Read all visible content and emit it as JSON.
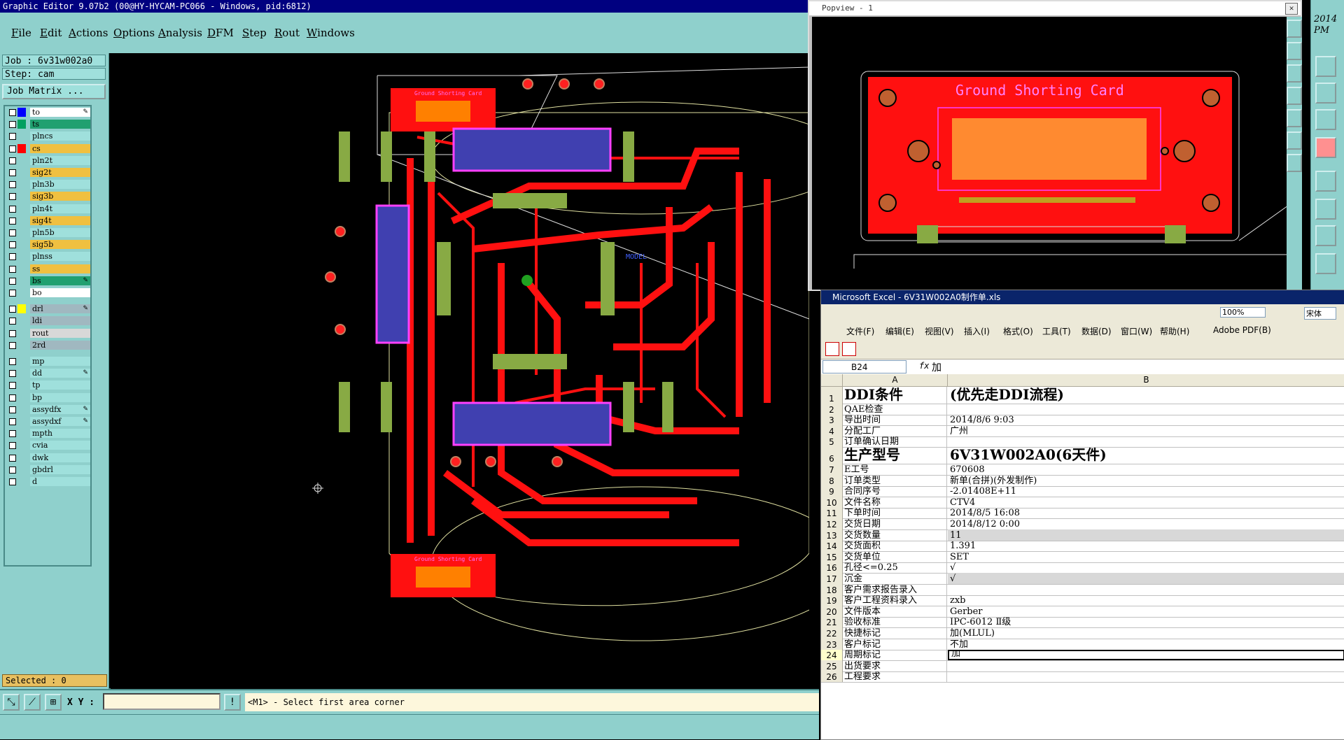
{
  "editor": {
    "title": "Graphic Editor 9.07b2 (00@HY-HYCAM-PC066 - Windows, pid:6812)",
    "menu": [
      "File",
      "Edit",
      "Actions",
      "Options",
      "Analysis",
      "DFM",
      "Step",
      "Rout",
      "Windows"
    ],
    "job_label": "Job : 6v31w002a0",
    "step_label": "Step: cam",
    "job_matrix_label": "Job Matrix ...",
    "layers": [
      {
        "name": "to",
        "color": "#0000ff",
        "name_bg": "#ffffff",
        "edit": true
      },
      {
        "name": "ts",
        "color": "#00a060",
        "name_bg": "#20a070",
        "edit": false
      },
      {
        "name": "plncs",
        "color": "",
        "name_bg": "#9fe0dc",
        "edit": false
      },
      {
        "name": "cs",
        "color": "#ff0000",
        "name_bg": "#f0c040",
        "edit": false
      },
      {
        "name": "pln2t",
        "color": "",
        "name_bg": "#9fe0dc",
        "edit": false
      },
      {
        "name": "sig2t",
        "color": "",
        "name_bg": "#f0c040",
        "edit": false
      },
      {
        "name": "pln3b",
        "color": "",
        "name_bg": "#9fe0dc",
        "edit": false
      },
      {
        "name": "sig3b",
        "color": "",
        "name_bg": "#f0c040",
        "edit": false
      },
      {
        "name": "pln4t",
        "color": "",
        "name_bg": "#9fe0dc",
        "edit": false
      },
      {
        "name": "sig4t",
        "color": "",
        "name_bg": "#f0c040",
        "edit": false
      },
      {
        "name": "pln5b",
        "color": "",
        "name_bg": "#9fe0dc",
        "edit": false
      },
      {
        "name": "sig5b",
        "color": "",
        "name_bg": "#f0c040",
        "edit": false
      },
      {
        "name": "plnss",
        "color": "",
        "name_bg": "#9fe0dc",
        "edit": false
      },
      {
        "name": "ss",
        "color": "",
        "name_bg": "#f0c040",
        "edit": false
      },
      {
        "name": "bs",
        "color": "",
        "name_bg": "#20a070",
        "edit": true
      },
      {
        "name": "bo",
        "color": "",
        "name_bg": "#ffffff",
        "edit": false
      },
      {
        "name": "drl",
        "color": "#ffff00",
        "name_bg": "#a0b8c0",
        "edit": true
      },
      {
        "name": "ldi",
        "color": "",
        "name_bg": "#a0b8c0",
        "edit": false
      },
      {
        "name": "rout",
        "color": "",
        "name_bg": "#d8d8d8",
        "edit": false
      },
      {
        "name": "2rd",
        "color": "",
        "name_bg": "#a0b8c0",
        "edit": false
      },
      {
        "name": "mp",
        "color": "",
        "name_bg": "#9fe0dc",
        "edit": false
      },
      {
        "name": "dd",
        "color": "",
        "name_bg": "#9fe0dc",
        "edit": true
      },
      {
        "name": "tp",
        "color": "",
        "name_bg": "#9fe0dc",
        "edit": false
      },
      {
        "name": "bp",
        "color": "",
        "name_bg": "#9fe0dc",
        "edit": false
      },
      {
        "name": "assydfx",
        "color": "",
        "name_bg": "#9fe0dc",
        "edit": true
      },
      {
        "name": "assydxf",
        "color": "",
        "name_bg": "#9fe0dc",
        "edit": true
      },
      {
        "name": "mpth",
        "color": "",
        "name_bg": "#9fe0dc",
        "edit": false
      },
      {
        "name": "cvia",
        "color": "",
        "name_bg": "#9fe0dc",
        "edit": false
      },
      {
        "name": "dwk",
        "color": "",
        "name_bg": "#9fe0dc",
        "edit": false
      },
      {
        "name": "gbdrl",
        "color": "",
        "name_bg": "#9fe0dc",
        "edit": false
      },
      {
        "name": "d",
        "color": "",
        "name_bg": "#9fe0dc",
        "edit": false
      }
    ],
    "selected_label": "Selected : 0",
    "xy_label": "X Y :",
    "xy_value": "",
    "prompt": "<M1> - Select first area corner",
    "board_text": "Ground Shorting Card",
    "model_text": "MODEL"
  },
  "popview": {
    "title": "Popview - 1",
    "close": "✕",
    "board_text": "Ground Shorting Card"
  },
  "right_tools": {
    "year": "2014",
    "ampm": "PM"
  },
  "excel": {
    "title": "Microsoft Excel - 6V31W002A0制作单.xls",
    "menu": [
      "文件(F)",
      "编辑(E)",
      "视图(V)",
      "插入(I)",
      "格式(O)",
      "工具(T)",
      "数据(D)",
      "窗口(W)",
      "帮助(H)",
      "Adobe PDF(B)"
    ],
    "zoom": "100%",
    "font": "宋体",
    "namebox": "B24",
    "fx": "fx",
    "formula_value": "加",
    "columns": [
      "A",
      "B"
    ],
    "rows": [
      {
        "n": "1",
        "a": "DDI条件",
        "b": "(优先走DDI流程)",
        "big": true
      },
      {
        "n": "2",
        "a": "QAE检查",
        "b": ""
      },
      {
        "n": "3",
        "a": "导出时间",
        "b": "2014/8/6 9:03"
      },
      {
        "n": "4",
        "a": "分配工厂",
        "b": "广州"
      },
      {
        "n": "5",
        "a": "订单确认日期",
        "b": ""
      },
      {
        "n": "6",
        "a": "生产型号",
        "b": "6V31W002A0(6天件)",
        "big": true
      },
      {
        "n": "7",
        "a": "E工号",
        "b": "670608"
      },
      {
        "n": "8",
        "a": "订单类型",
        "b": "新单(合拼)(外发制作)"
      },
      {
        "n": "9",
        "a": "合同序号",
        "b": "-2.01408E+11"
      },
      {
        "n": "10",
        "a": "文件名称",
        "b": "CTV4"
      },
      {
        "n": "11",
        "a": "下单时间",
        "b": "2014/8/5 16:08"
      },
      {
        "n": "12",
        "a": "交货日期",
        "b": "2014/8/12 0:00"
      },
      {
        "n": "13",
        "a": "交货数量",
        "b": "11",
        "shade": true
      },
      {
        "n": "14",
        "a": "交货面积",
        "b": "1.391"
      },
      {
        "n": "15",
        "a": "交货单位",
        "b": "SET"
      },
      {
        "n": "16",
        "a": "孔径<=0.25",
        "b": "√"
      },
      {
        "n": "17",
        "a": "沉金",
        "b": "√",
        "shade": true
      },
      {
        "n": "18",
        "a": "客户需求报告录入",
        "b": ""
      },
      {
        "n": "19",
        "a": "客户工程资料录入",
        "b": "zxb"
      },
      {
        "n": "20",
        "a": "文件版本",
        "b": "Gerber"
      },
      {
        "n": "21",
        "a": "验收标准",
        "b": "IPC-6012 Ⅱ级"
      },
      {
        "n": "22",
        "a": "快捷标记",
        "b": "加(MLUL)"
      },
      {
        "n": "23",
        "a": "客户标记",
        "b": "不加"
      },
      {
        "n": "24",
        "a": "周期标记",
        "b": "加",
        "sel": true
      },
      {
        "n": "25",
        "a": "出货要求",
        "b": ""
      },
      {
        "n": "26",
        "a": "工程要求",
        "b": ""
      }
    ]
  }
}
